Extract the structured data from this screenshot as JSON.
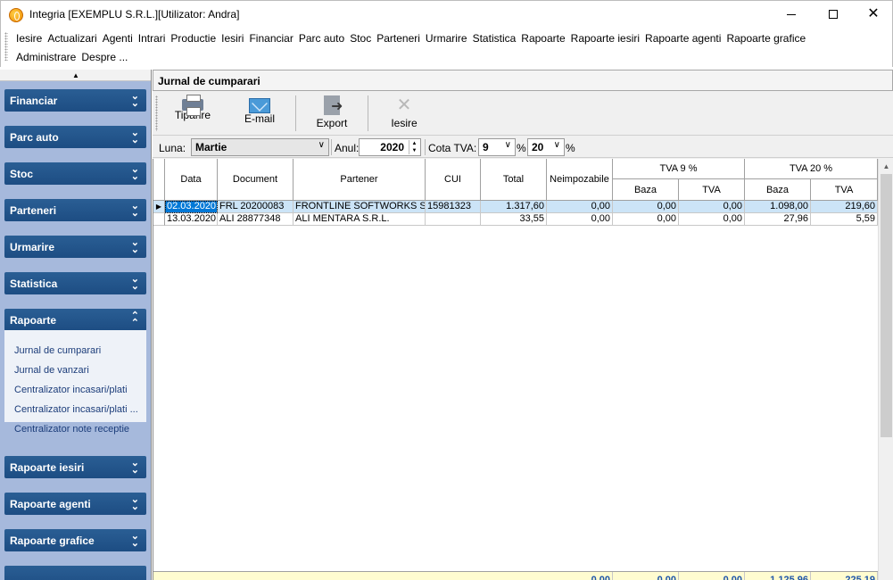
{
  "window": {
    "title": "Integria [EXEMPLU S.R.L.][Utilizator: Andra]",
    "minimize": "minimize-icon",
    "maximize": "maximize-icon",
    "close_glyph": "✕"
  },
  "menu": {
    "row1": [
      "Iesire",
      "Actualizari",
      "Agenti",
      "Intrari",
      "Productie",
      "Iesiri",
      "Financiar",
      "Parc auto",
      "Stoc",
      "Parteneri",
      "Urmarire",
      "Statistica",
      "Rapoarte",
      "Rapoarte iesiri",
      "Rapoarte agenti",
      "Rapoarte grafice"
    ],
    "row2": [
      "Administrare",
      "Despre ..."
    ]
  },
  "sidebar": {
    "groups": [
      {
        "label": "Financiar",
        "chevron": "»"
      },
      {
        "label": "Parc auto",
        "chevron": "»"
      },
      {
        "label": "Stoc",
        "chevron": "»"
      },
      {
        "label": "Parteneri",
        "chevron": "»"
      },
      {
        "label": "Urmarire",
        "chevron": "»"
      },
      {
        "label": "Statistica",
        "chevron": "»"
      },
      {
        "label": "Rapoarte",
        "chevron": "«"
      },
      {
        "label": "Rapoarte iesiri",
        "chevron": "»"
      },
      {
        "label": "Rapoarte agenti",
        "chevron": "»"
      },
      {
        "label": "Rapoarte grafice",
        "chevron": "»"
      }
    ],
    "rapoarte_items": [
      "Jurnal de cumparari",
      "Jurnal de vanzari",
      "Centralizator incasari/plati",
      "Centralizator incasari/plati ...",
      "Centralizator note receptie"
    ]
  },
  "main": {
    "title": "Jurnal de cumparari",
    "toolbar": {
      "print": "Tiparire",
      "email": "E-mail",
      "export": "Export",
      "exit": "Iesire"
    },
    "filters": {
      "luna_label": "Luna:",
      "luna_value": "Martie",
      "anul_label": "Anul:",
      "anul_value": "2020",
      "cota_label": "Cota TVA:",
      "cota1": "9",
      "cota2": "20",
      "pct": "%"
    },
    "grid": {
      "headers": {
        "data": "Data",
        "document": "Document",
        "partener": "Partener",
        "cui": "CUI",
        "total": "Total",
        "neimpozabile": "Neimpozabile",
        "tva9": "TVA 9 %",
        "tva20": "TVA 20 %",
        "baza": "Baza",
        "tva": "TVA"
      },
      "rows": [
        {
          "data": "02.03.2020",
          "document": "FRL 20200083",
          "partener": "FRONTLINE SOFTWORKS SRL",
          "cui": "15981323",
          "total": "1.317,60",
          "neimp": "0,00",
          "baza9": "0,00",
          "tva9": "0,00",
          "baza20": "1.098,00",
          "tva20": "219,60"
        },
        {
          "data": "13.03.2020",
          "document": "ALI 28877348",
          "partener": "ALI MENTARA S.R.L.",
          "cui": "",
          "total": "33,55",
          "neimp": "0,00",
          "baza9": "0,00",
          "tva9": "0,00",
          "baza20": "27,96",
          "tva20": "5,59"
        }
      ],
      "totals": {
        "neimp": "0,00",
        "baza9": "0,00",
        "tva9": "0,00",
        "baza20": "1.125,96",
        "tva20": "225,19"
      }
    }
  }
}
